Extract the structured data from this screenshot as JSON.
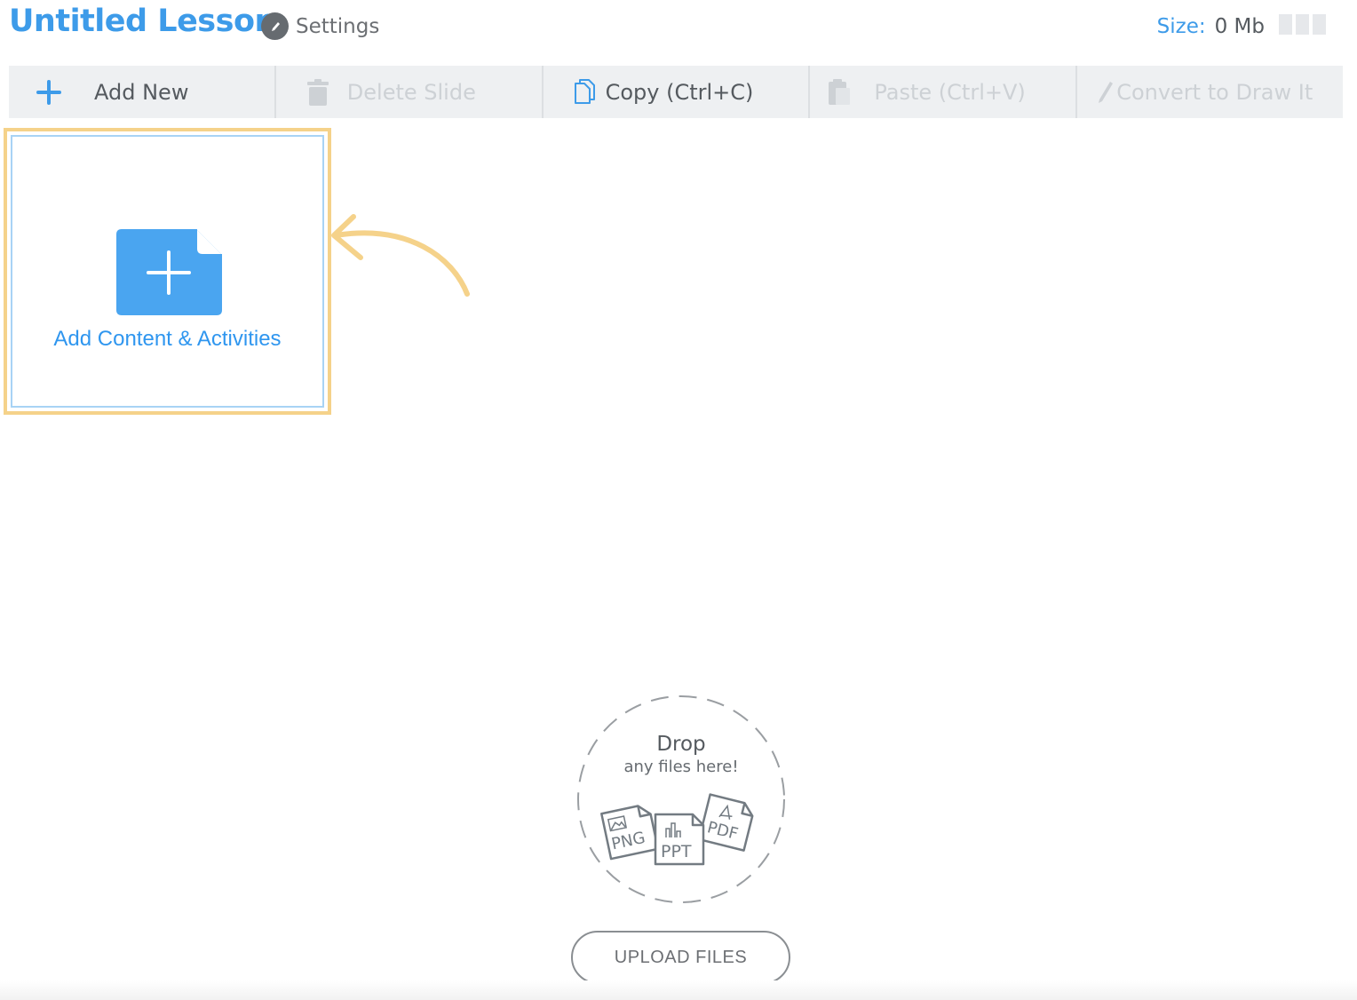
{
  "header": {
    "title": "Untitled Lesson",
    "settings_label": "Settings",
    "size_label": "Size:",
    "size_value": "0 Mb"
  },
  "toolbar": {
    "add_new": "Add New",
    "delete_slide": "Delete Slide",
    "copy": "Copy (Ctrl+C)",
    "paste": "Paste (Ctrl+V)",
    "convert": "Convert to Draw It"
  },
  "slide": {
    "add_content_label": "Add Content & Activities"
  },
  "dropzone": {
    "title": "Drop",
    "subtitle": "any files here!",
    "file_types": [
      "PNG",
      "PPT",
      "PDF"
    ],
    "upload_label": "UPLOAD FILES"
  },
  "colors": {
    "accent": "#3d9be9",
    "highlight": "#f5d28a",
    "disabled_text": "#cdd1d5"
  }
}
